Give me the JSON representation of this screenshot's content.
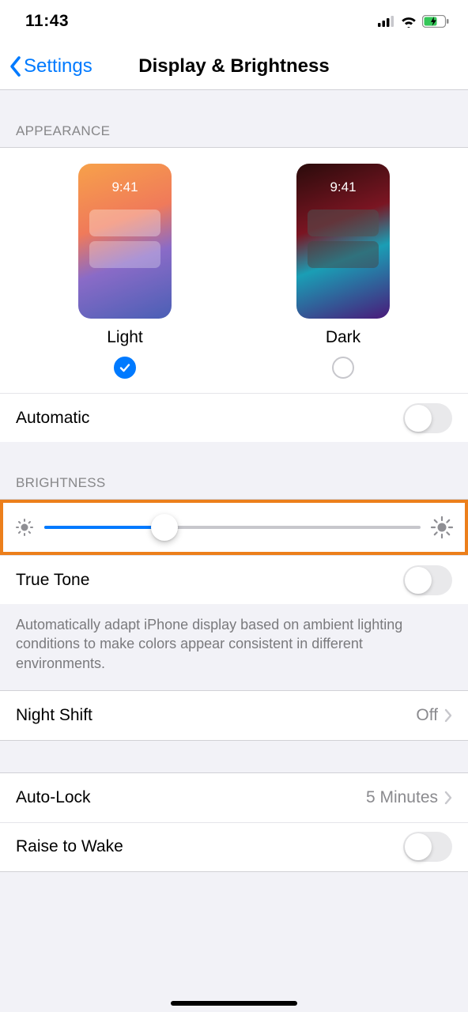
{
  "status": {
    "time": "11:43"
  },
  "nav": {
    "back": "Settings",
    "title": "Display & Brightness"
  },
  "appearance": {
    "header": "APPEARANCE",
    "preview_time": "9:41",
    "light_label": "Light",
    "dark_label": "Dark",
    "selected": "light",
    "automatic_label": "Automatic",
    "automatic_on": false
  },
  "brightness": {
    "header": "BRIGHTNESS",
    "value_percent": 32,
    "true_tone_label": "True Tone",
    "true_tone_on": false,
    "true_tone_desc": "Automatically adapt iPhone display based on ambient lighting conditions to make colors appear consistent in different environments."
  },
  "night_shift": {
    "label": "Night Shift",
    "value": "Off"
  },
  "auto_lock": {
    "label": "Auto-Lock",
    "value": "5 Minutes"
  },
  "raise_to_wake": {
    "label": "Raise to Wake",
    "on": false
  },
  "highlight": {
    "color": "#ec7f1b"
  }
}
